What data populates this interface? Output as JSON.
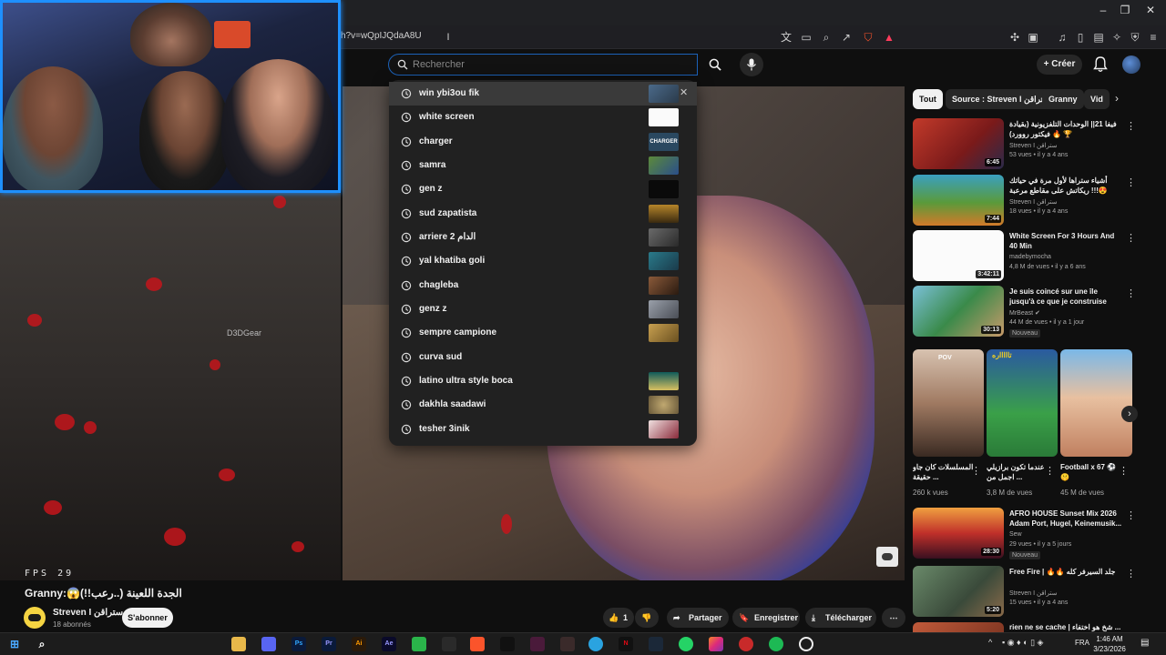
{
  "browser": {
    "url": "h?v=wQpIJQdaA8U",
    "window_controls": [
      "–",
      "❐",
      "✕"
    ]
  },
  "header": {
    "search_placeholder": "Rechercher",
    "create_label": "Créer"
  },
  "suggestions": [
    "win ybi3ou fik",
    "white screen",
    "charger",
    "samra",
    "gen z",
    "sud zapatista",
    "arriere 2 الدام",
    "yal khatiba goli",
    "chagleba",
    "genz z",
    "sempre campione",
    "curva sud",
    "latino ultra style boca",
    "dakhla saadawi",
    "tesher 3inik"
  ],
  "suggestion_thumb_texts": {
    "charger": "CHARGER"
  },
  "video": {
    "fps_text": "FPS  29",
    "watermark": "D3DGear",
    "title": "Granny:😱(!!رعب..) الجدة اللعينة",
    "channel": "Streven I ستراقن",
    "subscribers": "18 abonnés",
    "subscribe_label": "S'abonner",
    "likes": "1",
    "share_label": "Partager",
    "save_label": "Enregistrer",
    "download_label": "Télécharger"
  },
  "chips": [
    "Tout",
    "Source : Streven I ستراقن",
    "Granny",
    "Vid"
  ],
  "recommendations": [
    {
      "title": "فيفا 21|| الوحدات التلفزيونية (بقيادة فيكتور روورد) 🔥 🏆",
      "channel": "Streven I ستراقن",
      "meta": "53 vues • il y a 4 ans",
      "duration": "6:45",
      "badge": ""
    },
    {
      "title": "أشياء ستراها لأول مرة في حياتك 😍!!! ريكاتش على مقاطع مرعبة",
      "channel": "Streven I ستراقن",
      "meta": "18 vues • il y a 4 ans",
      "duration": "7:44",
      "badge": ""
    },
    {
      "title": "White Screen For 3 Hours And 40 Min",
      "channel": "madebymocha",
      "meta": "4,8 M de vues • il y a 6 ans",
      "duration": "3:42:11",
      "badge": ""
    },
    {
      "title": "Je suis coincé sur une île jusqu'à ce que je construise une...",
      "channel": "MrBeast ✔",
      "meta": "44 M de vues • il y a 1 jour",
      "duration": "30:13",
      "badge": "Nouveau"
    },
    {
      "title": "AFRO HOUSE Sunset Mix 2026 Adam Port, Hugel, Keinemusik...",
      "channel": "Sew",
      "meta": "29 vues • il y a 5 jours",
      "duration": "28:30",
      "badge": "Nouveau"
    },
    {
      "title": "Free Fire | 🔥🔥 جلد السيرفر كله",
      "channel": "Streven I ستراقن",
      "meta": "15 vues • il y a 4 ans",
      "duration": "5:20",
      "badge": ""
    },
    {
      "title": "rien ne se cache | شخ هو اختفاء ...",
      "channel": "",
      "meta": "",
      "duration": "",
      "badge": ""
    }
  ],
  "shorts": [
    {
      "title": "المسلسلات كان جاو حقيقة ...",
      "views": "260 k vues",
      "overlay": "POV"
    },
    {
      "title": "عندما تكون برازيلي اجمل من ...",
      "views": "3,8 M de vues",
      "overlay": "تاااااره"
    },
    {
      "title": "Football x 67 ⚽🤫",
      "views": "45 M de vues",
      "overlay": ""
    }
  ],
  "taskbar": {
    "lang": "FRA",
    "time": "1:46 AM",
    "date": "3/23/2026",
    "apps": [
      "Ps",
      "Pr",
      "Ai",
      "Ae"
    ]
  },
  "colors": {
    "accent_blue": "#1e90ff",
    "youtube_red": "#ff0000",
    "blood_red": "#c4151b"
  }
}
